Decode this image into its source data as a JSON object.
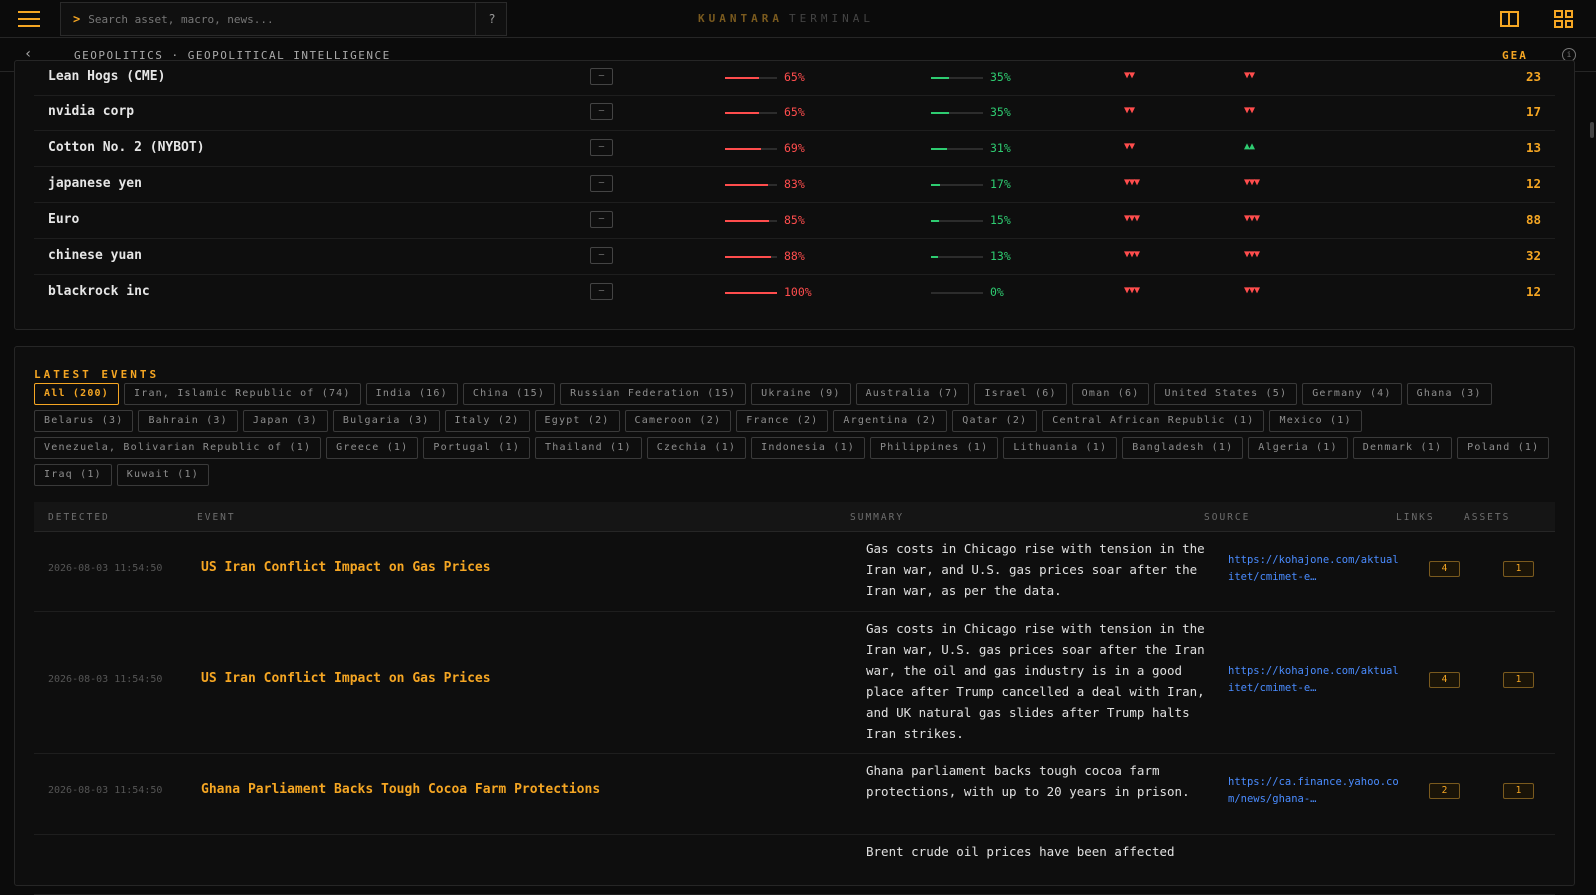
{
  "topbar": {
    "search_prompt": ">",
    "search_placeholder": "Search asset, macro, news...",
    "help_label": "?",
    "brand_primary": "KUANTARA",
    "brand_secondary": "TERMINAL"
  },
  "breadcrumb": {
    "path": "GEOPOLITICS · GEOPOLITICAL INTELLIGENCE",
    "code": "GEA"
  },
  "assets": [
    {
      "name": "Lean Hogs (CME)",
      "mini": "—",
      "bear_pct": 65,
      "bear_label": "65%",
      "bull_pct": 35,
      "bull_label": "35%",
      "t1": "▼▼",
      "t1c": "red",
      "t2": "▼▼",
      "t2c": "red",
      "score": "23"
    },
    {
      "name": "nvidia corp",
      "mini": "—",
      "bear_pct": 65,
      "bear_label": "65%",
      "bull_pct": 35,
      "bull_label": "35%",
      "t1": "▼▼",
      "t1c": "red",
      "t2": "▼▼",
      "t2c": "red",
      "score": "17"
    },
    {
      "name": "Cotton No. 2 (NYBOT)",
      "mini": "—",
      "bear_pct": 69,
      "bear_label": "69%",
      "bull_pct": 31,
      "bull_label": "31%",
      "t1": "▼▼",
      "t1c": "red",
      "t2": "▲▲",
      "t2c": "green",
      "score": "13"
    },
    {
      "name": "japanese yen",
      "mini": "—",
      "bear_pct": 83,
      "bear_label": "83%",
      "bull_pct": 17,
      "bull_label": "17%",
      "t1": "▼▼▼",
      "t1c": "red",
      "t2": "▼▼▼",
      "t2c": "red",
      "score": "12"
    },
    {
      "name": "Euro",
      "mini": "—",
      "bear_pct": 85,
      "bear_label": "85%",
      "bull_pct": 15,
      "bull_label": "15%",
      "t1": "▼▼▼",
      "t1c": "red",
      "t2": "▼▼▼",
      "t2c": "red",
      "score": "88"
    },
    {
      "name": "chinese yuan",
      "mini": "—",
      "bear_pct": 88,
      "bear_label": "88%",
      "bull_pct": 13,
      "bull_label": "13%",
      "t1": "▼▼▼",
      "t1c": "red",
      "t2": "▼▼▼",
      "t2c": "red",
      "score": "32"
    },
    {
      "name": "blackrock inc",
      "mini": "—",
      "bear_pct": 100,
      "bear_label": "100%",
      "bull_pct": 0,
      "bull_label": "0%",
      "t1": "▼▼▼",
      "t1c": "red",
      "t2": "▼▼▼",
      "t2c": "red",
      "score": "12"
    }
  ],
  "events_section": {
    "title": "LATEST EVENTS",
    "filters": [
      "All (200)",
      "Iran, Islamic Republic of (74)",
      "India (16)",
      "China (15)",
      "Russian Federation (15)",
      "Ukraine (9)",
      "Australia (7)",
      "Israel (6)",
      "Oman (6)",
      "United States (5)",
      "Germany (4)",
      "Ghana (3)",
      "Belarus (3)",
      "Bahrain (3)",
      "Japan (3)",
      "Bulgaria (3)",
      "Italy (2)",
      "Egypt (2)",
      "Cameroon (2)",
      "France (2)",
      "Argentina (2)",
      "Qatar (2)",
      "Central African Republic (1)",
      "Mexico (1)",
      "Venezuela, Bolivarian Republic of (1)",
      "Greece (1)",
      "Portugal (1)",
      "Thailand (1)",
      "Czechia (1)",
      "Indonesia (1)",
      "Philippines (1)",
      "Lithuania (1)",
      "Bangladesh (1)",
      "Algeria (1)",
      "Denmark (1)",
      "Poland (1)",
      "Iraq (1)",
      "Kuwait (1)"
    ],
    "active_filter": 0,
    "columns": {
      "detected": "DETECTED",
      "event": "EVENT",
      "summary": "SUMMARY",
      "source": "SOURCE",
      "links": "LINKS",
      "assets": "ASSETS"
    },
    "rows": [
      {
        "detected": "2026-08-03 11:54:50",
        "event": "US Iran Conflict Impact on Gas Prices",
        "summary": "Gas costs in Chicago rise with tension in the Iran war, and U.S. gas prices soar after the Iran war, as per the data.",
        "source": "https://kohajone.com/aktualitet/cmimet-e…",
        "links": "4",
        "assets": "1"
      },
      {
        "detected": "2026-08-03 11:54:50",
        "event": "US Iran Conflict Impact on Gas Prices",
        "summary": "Gas costs in Chicago rise with tension in the Iran war, U.S. gas prices soar after the Iran war, the oil and gas industry is in a good place after Trump cancelled a deal with Iran, and UK natural gas slides after Trump halts Iran strikes.",
        "source": "https://kohajone.com/aktualitet/cmimet-e…",
        "links": "4",
        "assets": "1"
      },
      {
        "detected": "2026-08-03 11:54:50",
        "event": "Ghana Parliament Backs Tough Cocoa Farm Protections",
        "summary": "Ghana parliament backs tough cocoa farm protections, with up to 20 years in prison.",
        "source": "https://ca.finance.yahoo.com/news/ghana-…",
        "links": "2",
        "assets": "1"
      },
      {
        "detected": "",
        "event": "",
        "summary": "Brent crude oil prices have been affected",
        "source": "",
        "links": "",
        "assets": ""
      }
    ]
  }
}
